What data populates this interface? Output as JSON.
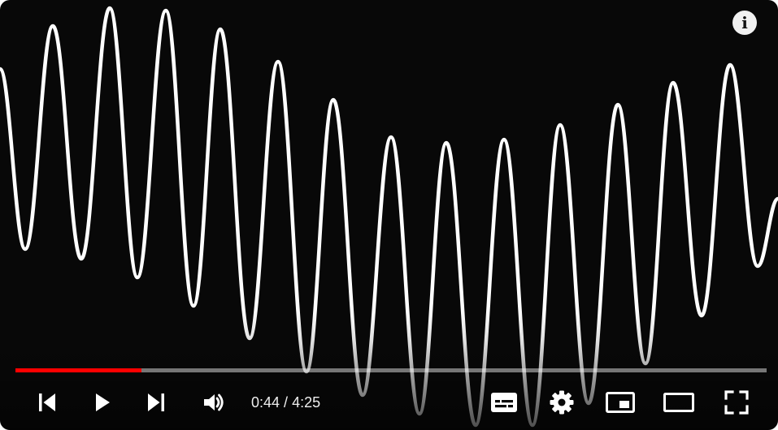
{
  "player": {
    "state": "paused",
    "time": {
      "current": "0:44",
      "separator": " / ",
      "duration": "4:25"
    },
    "progress_fraction": 0.168,
    "colors": {
      "background": "#080808",
      "played": "#ff0000",
      "track": "#9a9a9a",
      "icon": "#ffffff"
    },
    "info_label": "i",
    "controls_left": [
      "previous-icon",
      "play-icon",
      "next-icon",
      "volume-icon"
    ],
    "controls_right": [
      "subtitles-icon",
      "settings-gear-icon",
      "miniplayer-icon",
      "theater-mode-icon",
      "fullscreen-icon"
    ]
  }
}
